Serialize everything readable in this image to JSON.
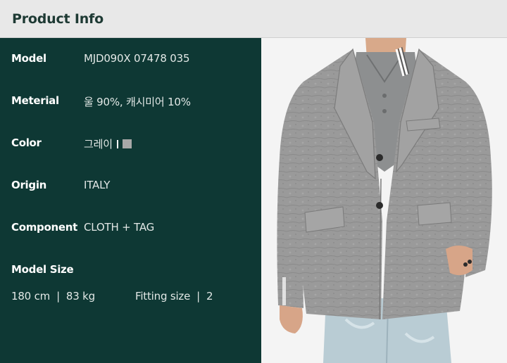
{
  "header": {
    "title": "Product Info"
  },
  "info": {
    "rows": [
      {
        "label": "Model",
        "value": "MJD090X 07478 035"
      },
      {
        "label": "Meterial",
        "value": "울 90%, 캐시미어 10%"
      },
      {
        "label": "Color",
        "value": "그레이"
      },
      {
        "label": "Origin",
        "value": "ITALY"
      },
      {
        "label": "Component",
        "value": "CLOTH + TAG"
      }
    ],
    "color_swatch": "#a8a8a8",
    "model_size": {
      "label": "Model Size",
      "height": "180 cm",
      "separator": "|",
      "weight": "83 kg",
      "fitting_label": "Fitting size",
      "fitting_value": "2"
    }
  },
  "colors": {
    "header_bg": "#e8e8e8",
    "header_text": "#1e3a34",
    "panel_bg": "#0e3834"
  },
  "photo": {
    "subject": "gray-wool-blazer-on-model"
  }
}
